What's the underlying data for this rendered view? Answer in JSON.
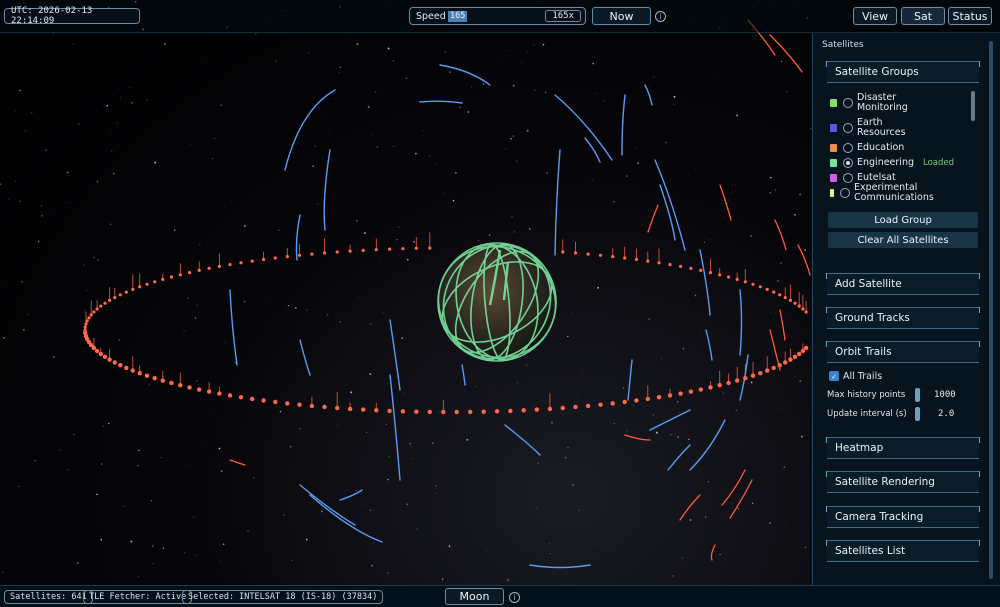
{
  "topbar": {
    "utc_label": "UTC: 2026-02-13 22:14:09",
    "speed_label": "Speed",
    "speed_input": "165",
    "speed_value": "165x",
    "now_button": "Now",
    "view_button": "View",
    "sat_button": "Sat",
    "status_button": "Status"
  },
  "panel": {
    "title": "Satellites",
    "satellite_groups": "Satellite Groups",
    "groups": [
      {
        "label_1": "Disaster",
        "label_2": "Monitoring",
        "color": "#8fdc6a",
        "selected": false
      },
      {
        "label_1": "Earth",
        "label_2": "Resources",
        "color": "#5b59e0",
        "selected": false
      },
      {
        "label_1": "Education",
        "label_2": "",
        "color": "#f08a4e",
        "selected": false
      },
      {
        "label_1": "Engineering",
        "label_2": "",
        "color": "#76e2a4",
        "selected": true,
        "status": "Loaded"
      },
      {
        "label_1": "Eutelsat",
        "label_2": "",
        "color": "#d55ae6",
        "selected": false
      },
      {
        "label_1": "Experimental",
        "label_2": "Communications",
        "color": "#e6f08a",
        "selected": false
      }
    ],
    "load_group": "Load Group",
    "clear_all": "Clear All Satellites",
    "add_satellite": "Add Satellite",
    "ground_tracks": "Ground Tracks",
    "orbit_trails": "Orbit Trails",
    "all_trails": "All Trails",
    "max_history_label": "Max history points",
    "max_history_value": "1000",
    "update_interval_label": "Update interval (s)",
    "update_interval_value": "2.0",
    "heatmap": "Heatmap",
    "satellite_rendering": "Satellite Rendering",
    "camera_tracking": "Camera Tracking",
    "satellites_list": "Satellites List"
  },
  "bottombar": {
    "satellites_count": "Satellites: 641",
    "tle_fetcher": "TLE Fetcher: Active",
    "selected": "Selected: INTELSAT 18 (IS-18) (37834)",
    "moon_button": "Moon"
  },
  "colors": {
    "orbit_red": "#ff6a4a",
    "orbit_blue": "#5a9cf0",
    "orbit_green": "#7be3a0",
    "panel_bg": "#07131d"
  }
}
